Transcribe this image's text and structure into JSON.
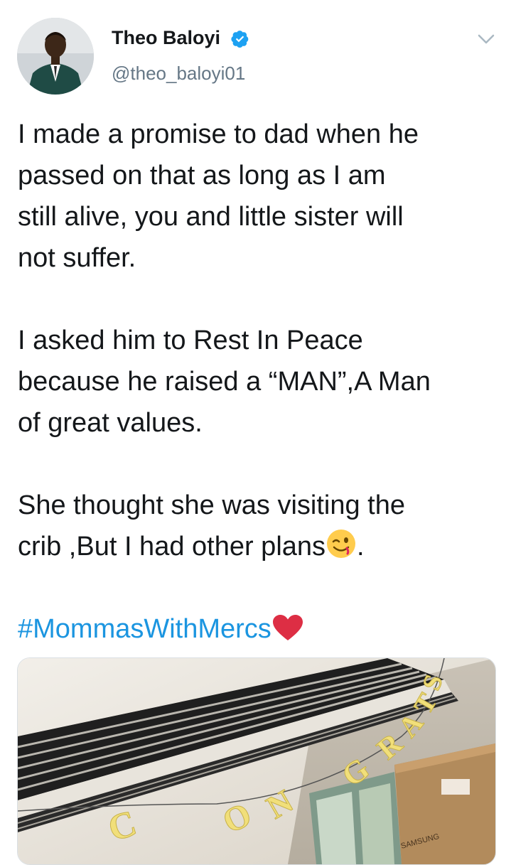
{
  "author": {
    "display_name": "Theo Baloyi",
    "handle": "@theo_baloyi01",
    "verified": true,
    "avatar_icon": "profile-photo"
  },
  "menu_icon": "chevron-down-icon",
  "tweet": {
    "lines": [
      "I made a promise to dad when he",
      "passed on that as long as I am",
      "still alive, you and little sister will",
      "not suffer.",
      "",
      "I asked him to Rest In Peace",
      "because he raised a “MAN”,A Man",
      "of great values.",
      "",
      "She thought she was visiting the",
      "crib ,But I had other plans",
      "",
      "#MommasWithMercs"
    ],
    "line11_suffix": ".",
    "hashtag": "#MommasWithMercs"
  },
  "media": {
    "banner_letters": [
      "C",
      "O",
      "N",
      "G",
      "R",
      "A",
      "T",
      "S"
    ],
    "box_brand": "SAMSUNG"
  },
  "colors": {
    "link": "#1b95e0",
    "verified_badge": "#1da1f2",
    "heart": "#e0245e",
    "text": "#14171a",
    "secondary": "#657786"
  }
}
